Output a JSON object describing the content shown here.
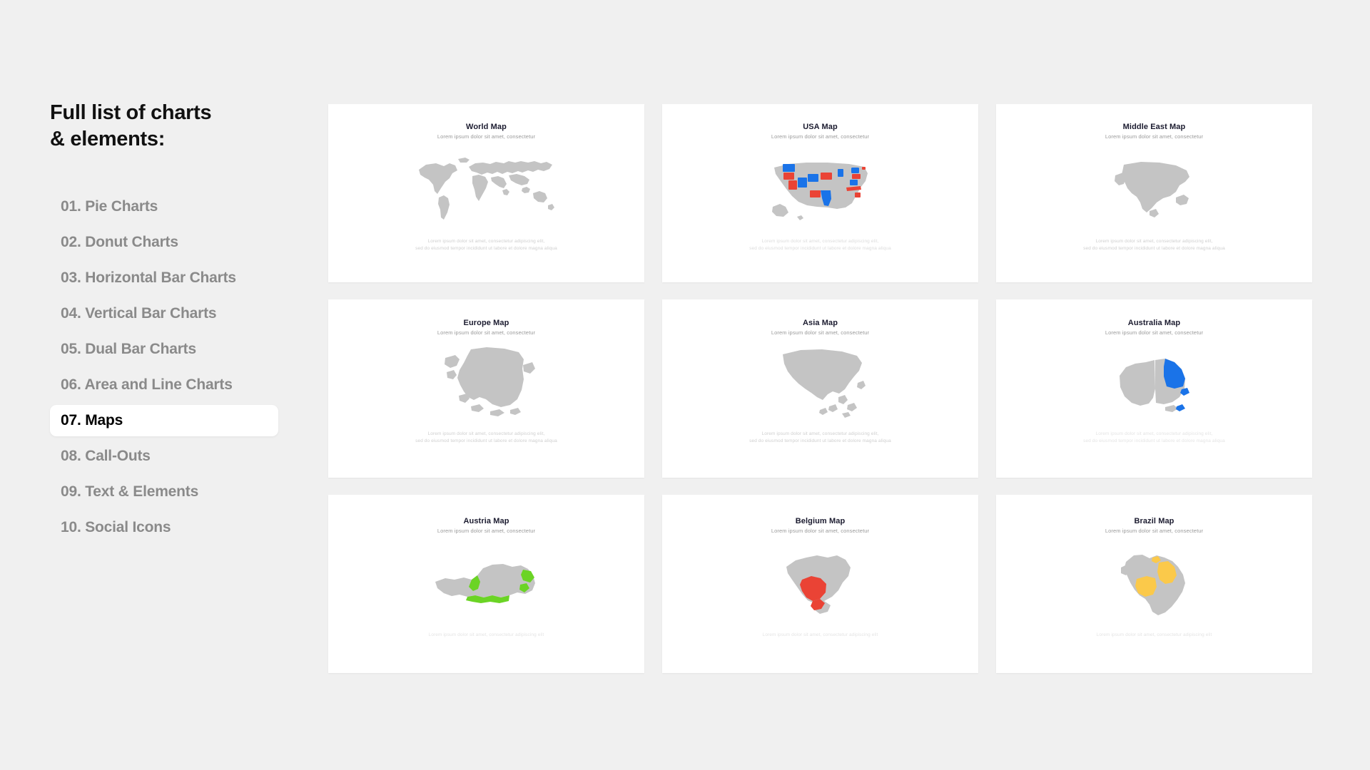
{
  "sidebar": {
    "title_line1": "Full list of charts",
    "title_line2": "& elements:",
    "items": [
      {
        "label": "01. Pie Charts",
        "active": false
      },
      {
        "label": "02. Donut Charts",
        "active": false
      },
      {
        "label": "03. Horizontal Bar Charts",
        "active": false
      },
      {
        "label": "04. Vertical Bar Charts",
        "active": false
      },
      {
        "label": "05. Dual Bar Charts",
        "active": false
      },
      {
        "label": "06. Area and Line Charts",
        "active": false
      },
      {
        "label": "07. Maps",
        "active": true
      },
      {
        "label": "08. Call-Outs",
        "active": false
      },
      {
        "label": "09. Text & Elements",
        "active": false
      },
      {
        "label": "10. Social Icons",
        "active": false
      }
    ]
  },
  "common": {
    "subtitle": "Lorem ipsum dolor sit amet, consectetur",
    "caption_line1": "Lorem ipsum dolor sit amet, consectetur adipiscing elit,",
    "caption_line2": "sed do eiusmod tempor incididunt ut labore et dolore magna aliqua",
    "caption_short": "Lorem ipsum dolor sit amet, consectetur adipiscing elit"
  },
  "colors": {
    "background": "#f0f0f0",
    "card": "#ffffff",
    "map_base": "#c4c4c4",
    "accent_blue": "#1a73e8",
    "accent_red": "#ea4335",
    "accent_green": "#6bd425",
    "accent_yellow": "#fbc94a",
    "title": "#1b1b2f",
    "muted": "#8a8a8a"
  },
  "cards": [
    {
      "title": "World Map",
      "subtitle": "Lorem ipsum dolor sit amet, consectetur",
      "caption_line1": "Lorem ipsum dolor sit amet, consectetur adipiscing elit,",
      "caption_line2": "sed do eiusmod tempor incididunt ut labore et dolore magna aliqua"
    },
    {
      "title": "USA Map",
      "subtitle": "Lorem ipsum dolor sit amet, consectetur",
      "caption_line1": "Lorem ipsum dolor sit amet, consectetur adipiscing elit,",
      "caption_line2": "sed do eiusmod tempor incididunt ut labore et dolore magna aliqua"
    },
    {
      "title": "Middle East Map",
      "subtitle": "Lorem ipsum dolor sit amet, consectetur",
      "caption_line1": "Lorem ipsum dolor sit amet, consectetur adipiscing elit,",
      "caption_line2": "sed do eiusmod tempor incididunt ut labore et dolore magna aliqua"
    },
    {
      "title": "Europe Map",
      "subtitle": "Lorem ipsum dolor sit amet, consectetur",
      "caption_line1": "Lorem ipsum dolor sit amet, consectetur adipiscing elit,",
      "caption_line2": "sed do eiusmod tempor incididunt ut labore et dolore magna aliqua"
    },
    {
      "title": "Asia Map",
      "subtitle": "Lorem ipsum dolor sit amet, consectetur",
      "caption_line1": "Lorem ipsum dolor sit amet, consectetur adipiscing elit,",
      "caption_line2": "sed do eiusmod tempor incididunt ut labore et dolore magna aliqua"
    },
    {
      "title": "Australia Map",
      "subtitle": "Lorem ipsum dolor sit amet, consectetur",
      "caption_line1": "Lorem ipsum dolor sit amet, consectetur adipiscing elit,",
      "caption_line2": "sed do eiusmod tempor incididunt ut labore et dolore magna aliqua"
    },
    {
      "title": "Austria Map",
      "subtitle": "Lorem ipsum dolor sit amet, consectetur",
      "caption_line1": "Lorem ipsum dolor sit amet, consectetur adipiscing elit",
      "caption_line2": ""
    },
    {
      "title": "Belgium Map",
      "subtitle": "Lorem ipsum dolor sit amet, consectetur",
      "caption_line1": "Lorem ipsum dolor sit amet, consectetur adipiscing elit",
      "caption_line2": ""
    },
    {
      "title": "Brazil Map",
      "subtitle": "Lorem ipsum dolor sit amet, consectetur",
      "caption_line1": "Lorem ipsum dolor sit amet, consectetur adipiscing elit",
      "caption_line2": ""
    }
  ]
}
